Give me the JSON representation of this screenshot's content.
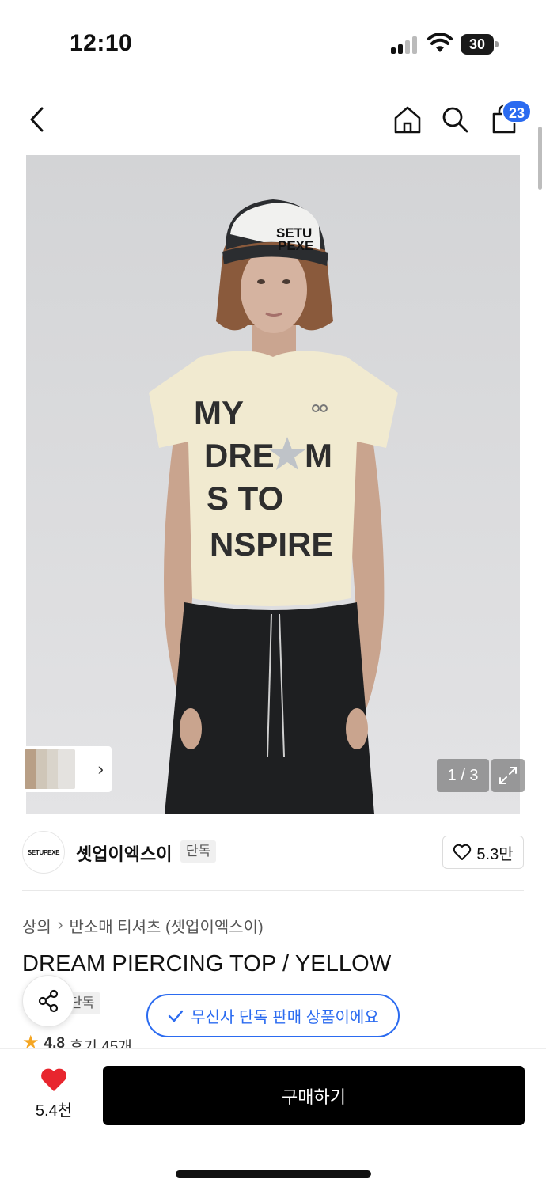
{
  "status_bar": {
    "time": "12:10",
    "battery": "30"
  },
  "nav": {
    "cart_count": "23"
  },
  "gallery": {
    "counter": "1 / 3"
  },
  "brand": {
    "logo_text": "SETUPEXE",
    "name": "셋업이엑스이",
    "tag": "단독",
    "likes": "5.3만"
  },
  "breadcrumb": {
    "category": "상의",
    "subcategory": "반소매 티셔츠 (셋업이엑스이)"
  },
  "product": {
    "title": "DREAM PIERCING TOP / YELLOW",
    "exclusive_tag": "단독",
    "exclusive_toast": "무신사 단독 판매 상품이에요",
    "rating": "4.8",
    "reviews": "후기 45개"
  },
  "image_text": {
    "cap_line1": "SETU",
    "cap_line2": "PEXE",
    "shirt_line1": "MY",
    "shirt_line2a": "DRE",
    "shirt_line2b": "M",
    "shirt_line3": "S TO",
    "shirt_line4": "NSPIRE"
  },
  "bottom_bar": {
    "heart_count": "5.4천",
    "buy_label": "구매하기"
  },
  "colors": {
    "accent_blue": "#2b6bf0",
    "heart_red": "#e8262e",
    "shirt_yellow": "#f1ead0"
  }
}
